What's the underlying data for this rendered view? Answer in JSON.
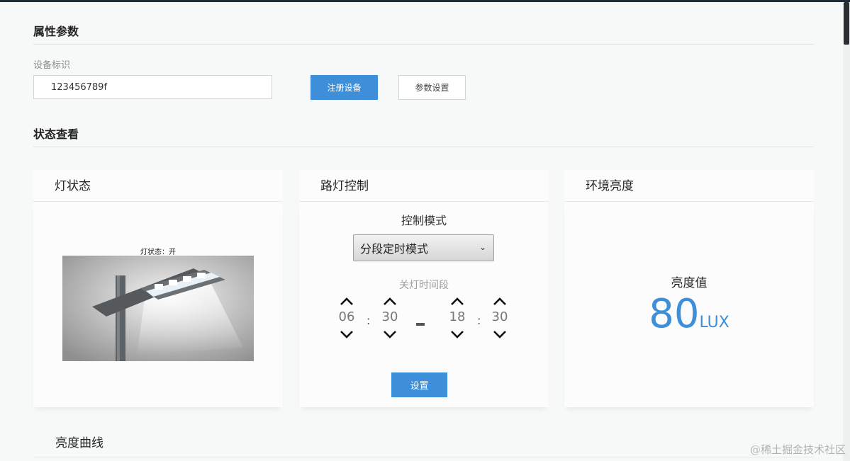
{
  "params": {
    "section_title": "属性参数",
    "device_label": "设备标识",
    "device_id": "123456789f",
    "register_button": "注册设备",
    "settings_button": "参数设置"
  },
  "status": {
    "section_title": "状态查看"
  },
  "lamp_card": {
    "title": "灯状态",
    "caption": "灯状态：开"
  },
  "control_card": {
    "title": "路灯控制",
    "mode_label": "控制模式",
    "mode_value": "分段定时模式",
    "period_label": "关灯时间段",
    "start_hour": "06",
    "start_minute": "30",
    "end_hour": "18",
    "end_minute": "30",
    "colon": ":",
    "set_button": "设置"
  },
  "lux_card": {
    "title": "环境亮度",
    "label": "亮度值",
    "value": "80",
    "unit": "LUX"
  },
  "curve": {
    "title": "亮度曲线"
  },
  "watermark": "@稀土掘金技术社区",
  "colors": {
    "accent": "#3d8fd9",
    "background": "#f7f9f8"
  }
}
